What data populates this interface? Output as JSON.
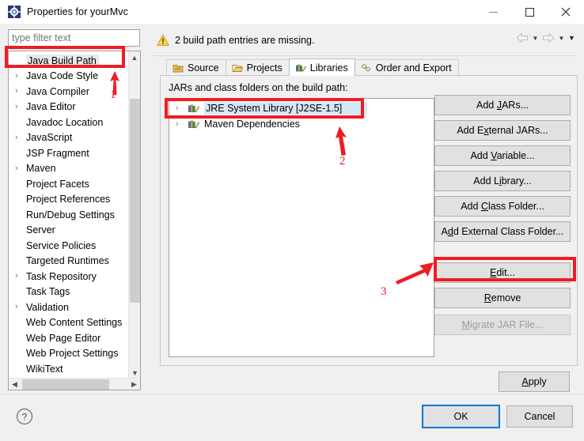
{
  "window": {
    "title": "Properties for yourMvc",
    "icon": "properties-gear-icon",
    "minimize": "–",
    "maximize": "☐",
    "close": "✕"
  },
  "sidebar": {
    "filter_placeholder": "type filter text",
    "filter_value": "",
    "items": [
      {
        "label": "Java Build Path",
        "expandable": false,
        "selected": true
      },
      {
        "label": "Java Code Style",
        "expandable": true,
        "selected": false
      },
      {
        "label": "Java Compiler",
        "expandable": true,
        "selected": false
      },
      {
        "label": "Java Editor",
        "expandable": true,
        "selected": false
      },
      {
        "label": "Javadoc Location",
        "expandable": false,
        "selected": false
      },
      {
        "label": "JavaScript",
        "expandable": true,
        "selected": false
      },
      {
        "label": "JSP Fragment",
        "expandable": false,
        "selected": false
      },
      {
        "label": "Maven",
        "expandable": true,
        "selected": false
      },
      {
        "label": "Project Facets",
        "expandable": false,
        "selected": false
      },
      {
        "label": "Project References",
        "expandable": false,
        "selected": false
      },
      {
        "label": "Run/Debug Settings",
        "expandable": false,
        "selected": false
      },
      {
        "label": "Server",
        "expandable": false,
        "selected": false
      },
      {
        "label": "Service Policies",
        "expandable": false,
        "selected": false
      },
      {
        "label": "Targeted Runtimes",
        "expandable": false,
        "selected": false
      },
      {
        "label": "Task Repository",
        "expandable": true,
        "selected": false
      },
      {
        "label": "Task Tags",
        "expandable": false,
        "selected": false
      },
      {
        "label": "Validation",
        "expandable": true,
        "selected": false
      },
      {
        "label": "Web Content Settings",
        "expandable": false,
        "selected": false
      },
      {
        "label": "Web Page Editor",
        "expandable": false,
        "selected": false
      },
      {
        "label": "Web Project Settings",
        "expandable": false,
        "selected": false
      },
      {
        "label": "WikiText",
        "expandable": false,
        "selected": false
      }
    ]
  },
  "message": {
    "icon": "warning-icon",
    "text": "2 build path entries are missing."
  },
  "nav": {
    "back_icon": "arrow-left-icon",
    "back_caret_icon": "chevron-down-icon",
    "forward_icon": "arrow-right-icon",
    "forward_caret_icon": "chevron-down-icon",
    "menu_caret_icon": "chevron-down-icon"
  },
  "tabs": [
    {
      "label": "Source",
      "icon": "source-folder-icon",
      "active": false
    },
    {
      "label": "Projects",
      "icon": "projects-folder-icon",
      "active": false
    },
    {
      "label": "Libraries",
      "icon": "libraries-books-icon",
      "active": true
    },
    {
      "label": "Order and Export",
      "icon": "order-export-icon",
      "active": false
    }
  ],
  "main": {
    "list_label": "JARs and class folders on the build path:",
    "entries": [
      {
        "label": "JRE System Library [J2SE-1.5]",
        "icon": "library-icon",
        "selected": true
      },
      {
        "label": "Maven Dependencies",
        "icon": "library-icon",
        "selected": false
      }
    ],
    "buttons": [
      {
        "label": "Add JARs...",
        "mnemonic": "J",
        "disabled": false
      },
      {
        "label": "Add External JARs...",
        "mnemonic": "x",
        "disabled": false
      },
      {
        "label": "Add Variable...",
        "mnemonic": "V",
        "disabled": false
      },
      {
        "label": "Add Library...",
        "mnemonic": "i",
        "disabled": false
      },
      {
        "label": "Add Class Folder...",
        "mnemonic": "C",
        "disabled": false
      },
      {
        "label": "Add External Class Folder...",
        "mnemonic": "d",
        "disabled": false
      },
      {
        "label": "Edit...",
        "mnemonic": "E",
        "disabled": false
      },
      {
        "label": "Remove",
        "mnemonic": "R",
        "disabled": false
      },
      {
        "label": "Migrate JAR File...",
        "mnemonic": "M",
        "disabled": true
      }
    ],
    "apply_label": "Apply",
    "apply_mnemonic": "A"
  },
  "footer": {
    "help_icon": "help-question-icon",
    "ok_label": "OK",
    "cancel_label": "Cancel"
  },
  "annotations": [
    {
      "id": "1",
      "label": "1",
      "target": "Java Build Path"
    },
    {
      "id": "2",
      "label": "2",
      "target": "JRE System Library [J2SE-1.5]"
    },
    {
      "id": "3",
      "label": "3",
      "target": "Edit..."
    }
  ],
  "colors": {
    "annotation_red": "#ee1c25",
    "selection_blue": "#d5e8f7",
    "focus_blue": "#0078d7",
    "dialog_bg": "#f0f0f0"
  }
}
